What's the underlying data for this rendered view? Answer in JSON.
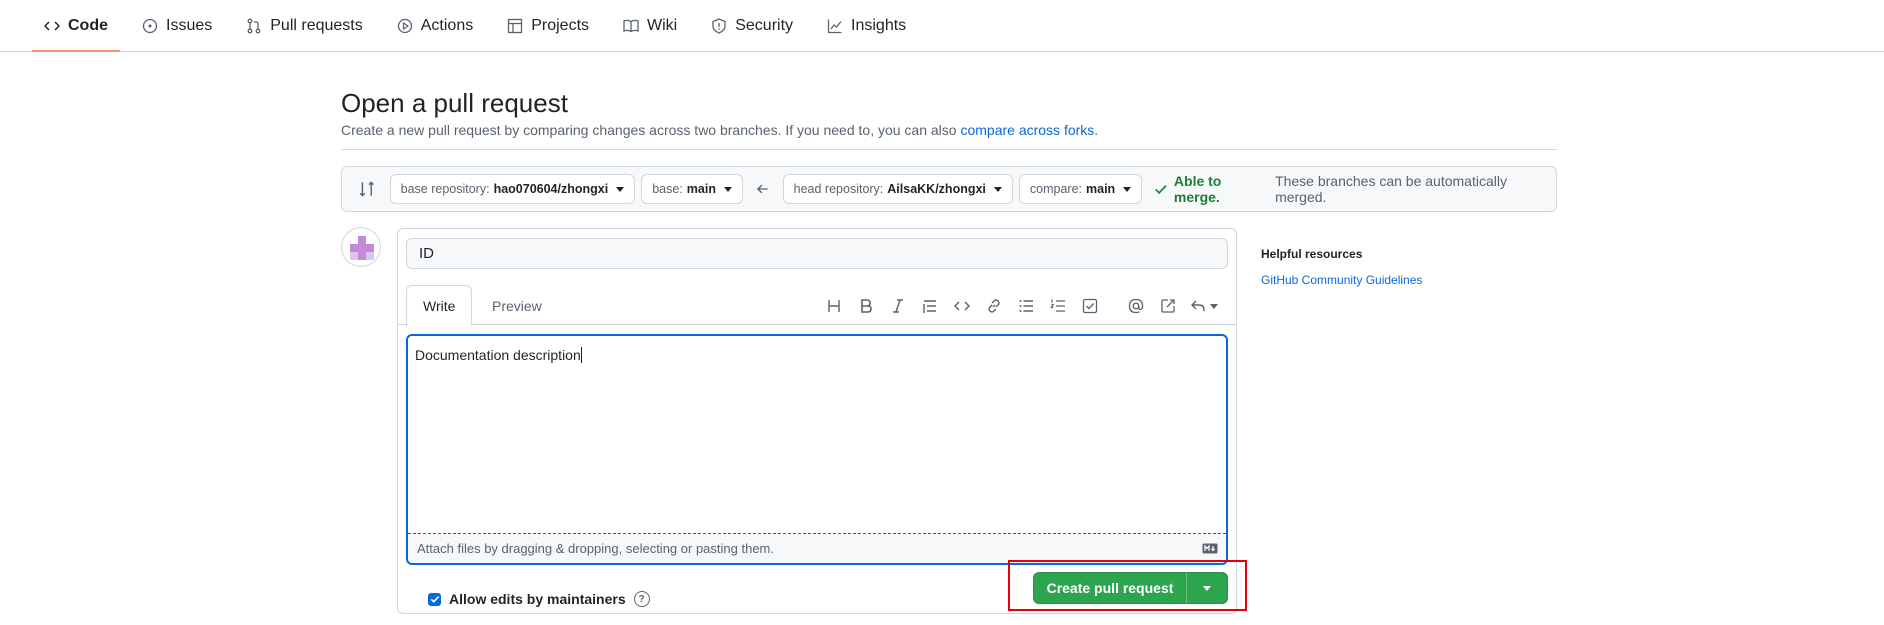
{
  "nav": {
    "tabs": [
      {
        "label": "Code",
        "icon": "code-icon",
        "active": true
      },
      {
        "label": "Issues",
        "icon": "issue-icon"
      },
      {
        "label": "Pull requests",
        "icon": "pull-request-icon"
      },
      {
        "label": "Actions",
        "icon": "play-icon"
      },
      {
        "label": "Projects",
        "icon": "table-icon"
      },
      {
        "label": "Wiki",
        "icon": "book-icon"
      },
      {
        "label": "Security",
        "icon": "shield-icon"
      },
      {
        "label": "Insights",
        "icon": "graph-icon"
      }
    ]
  },
  "header": {
    "title": "Open a pull request",
    "subtitle": "Create a new pull request by comparing changes across two branches. If you need to, you can also ",
    "subtitle_link": "compare across forks."
  },
  "compare": {
    "base_repo_label": "base repository: ",
    "base_repo_value": "hao070604/zhongxi",
    "base_label": "base: ",
    "base_value": "main",
    "head_repo_label": "head repository: ",
    "head_repo_value": "AilsaKK/zhongxi",
    "compare_label": "compare: ",
    "compare_value": "main",
    "merge_ok": "Able to merge.",
    "merge_desc": "These branches can be automatically merged."
  },
  "form": {
    "title_value": "ID",
    "tab_write": "Write",
    "tab_preview": "Preview",
    "body_value": "Documentation description",
    "attach_text": "Attach files by dragging & dropping, selecting or pasting them.",
    "allow_edits_label": "Allow edits by maintainers",
    "allow_edits_checked": true,
    "submit_label": "Create pull request"
  },
  "toolbar": {
    "icons": [
      "heading-icon",
      "bold-icon",
      "italic-icon",
      "quote-icon",
      "code-icon",
      "link-icon",
      "unordered-list-icon",
      "ordered-list-icon",
      "tasklist-icon",
      "mention-icon",
      "cross-reference-icon",
      "reply-icon"
    ]
  },
  "sidebar": {
    "title": "Helpful resources",
    "link": "GitHub Community Guidelines"
  },
  "colors": {
    "accent": "#0969da",
    "success": "#1a7f37",
    "button_green": "#2da44e",
    "highlight": "#e5000b",
    "tab_underline": "#fd8c73"
  }
}
